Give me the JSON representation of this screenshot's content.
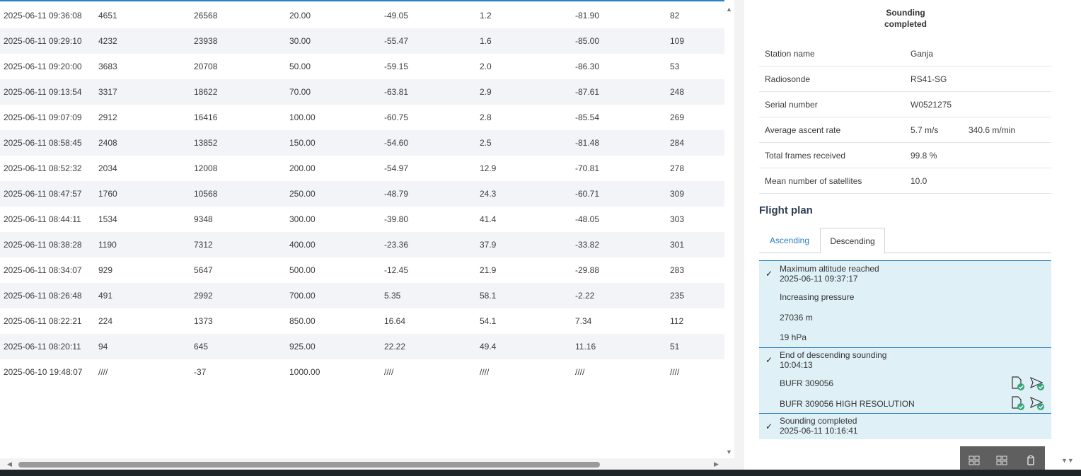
{
  "table": {
    "rows": [
      [
        "2025-06-11 09:36:08",
        "4651",
        "26568",
        "20.00",
        "-49.05",
        "1.2",
        "-81.90",
        "82"
      ],
      [
        "2025-06-11 09:29:10",
        "4232",
        "23938",
        "30.00",
        "-55.47",
        "1.6",
        "-85.00",
        "109"
      ],
      [
        "2025-06-11 09:20:00",
        "3683",
        "20708",
        "50.00",
        "-59.15",
        "2.0",
        "-86.30",
        "53"
      ],
      [
        "2025-06-11 09:13:54",
        "3317",
        "18622",
        "70.00",
        "-63.81",
        "2.9",
        "-87.61",
        "248"
      ],
      [
        "2025-06-11 09:07:09",
        "2912",
        "16416",
        "100.00",
        "-60.75",
        "2.8",
        "-85.54",
        "269"
      ],
      [
        "2025-06-11 08:58:45",
        "2408",
        "13852",
        "150.00",
        "-54.60",
        "2.5",
        "-81.48",
        "284"
      ],
      [
        "2025-06-11 08:52:32",
        "2034",
        "12008",
        "200.00",
        "-54.97",
        "12.9",
        "-70.81",
        "278"
      ],
      [
        "2025-06-11 08:47:57",
        "1760",
        "10568",
        "250.00",
        "-48.79",
        "24.3",
        "-60.71",
        "309"
      ],
      [
        "2025-06-11 08:44:11",
        "1534",
        "9348",
        "300.00",
        "-39.80",
        "41.4",
        "-48.05",
        "303"
      ],
      [
        "2025-06-11 08:38:28",
        "1190",
        "7312",
        "400.00",
        "-23.36",
        "37.9",
        "-33.82",
        "301"
      ],
      [
        "2025-06-11 08:34:07",
        "929",
        "5647",
        "500.00",
        "-12.45",
        "21.9",
        "-29.88",
        "283"
      ],
      [
        "2025-06-11 08:26:48",
        "491",
        "2992",
        "700.00",
        "5.35",
        "58.1",
        "-2.22",
        "235"
      ],
      [
        "2025-06-11 08:22:21",
        "224",
        "1373",
        "850.00",
        "16.64",
        "54.1",
        "7.34",
        "112"
      ],
      [
        "2025-06-11 08:20:11",
        "94",
        "645",
        "925.00",
        "22.22",
        "49.4",
        "11.16",
        "51"
      ],
      [
        "2025-06-10 19:48:07",
        "////",
        "-37",
        "1000.00",
        "////",
        "////",
        "////",
        "////"
      ]
    ]
  },
  "status": {
    "line1": "Sounding",
    "line2": "completed"
  },
  "info": {
    "station_label": "Station name",
    "station_value": "Ganja",
    "radiosonde_label": "Radiosonde",
    "radiosonde_value": "RS41-SG",
    "serial_label": "Serial number",
    "serial_value": "W0521275",
    "ascent_label": "Average ascent rate",
    "ascent_value": "5.7 m/s",
    "ascent_value2": "340.6 m/min",
    "frames_label": "Total frames received",
    "frames_value": "99.8 %",
    "satellites_label": "Mean number of satellites",
    "satellites_value": "10.0"
  },
  "flight_plan": {
    "title": "Flight plan",
    "tab_ascending": "Ascending",
    "tab_descending": "Descending",
    "check_glyph": "✓",
    "max_alt_title": "Maximum altitude reached",
    "max_alt_time": "2025-06-11 09:37:17",
    "increasing_pressure": "Increasing pressure",
    "altitude": "27036 m",
    "pressure": "19 hPa",
    "end_desc_title": "End of descending sounding",
    "end_desc_time": "10:04:13",
    "bufr1": "BUFR 309056",
    "bufr2": "BUFR 309056 HIGH RESOLUTION",
    "completed_title": "Sounding completed",
    "completed_time": "2025-06-11 10:16:41"
  },
  "colors": {
    "accent": "#2a80c4",
    "success": "#3aa37a",
    "plan_bg": "#dff0f7"
  }
}
